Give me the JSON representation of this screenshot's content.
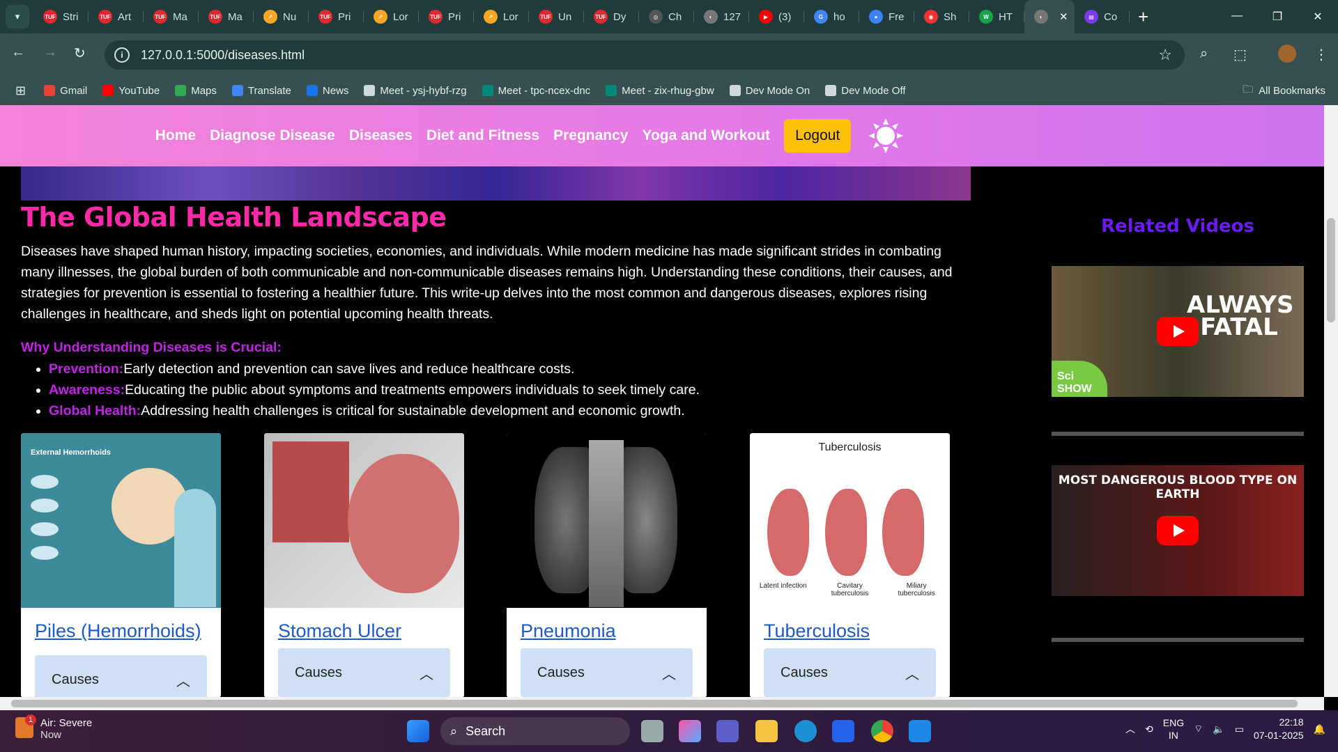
{
  "browser": {
    "tabs": [
      {
        "label": "Stri",
        "fav": "TUF",
        "color": "#e0282f"
      },
      {
        "label": "Art",
        "fav": "TUF",
        "color": "#e0282f"
      },
      {
        "label": "Ma",
        "fav": "TUF",
        "color": "#e0282f"
      },
      {
        "label": "Ma",
        "fav": "TUF",
        "color": "#e0282f"
      },
      {
        "label": "Nu",
        "fav": "↗",
        "color": "#f5a623"
      },
      {
        "label": "Pri",
        "fav": "TUF",
        "color": "#e0282f"
      },
      {
        "label": "Lor",
        "fav": "↗",
        "color": "#f5a623"
      },
      {
        "label": "Pri",
        "fav": "TUF",
        "color": "#e0282f"
      },
      {
        "label": "Lor",
        "fav": "↗",
        "color": "#f5a623"
      },
      {
        "label": "Un",
        "fav": "TUF",
        "color": "#e0282f"
      },
      {
        "label": "Dy",
        "fav": "TUF",
        "color": "#e0282f"
      },
      {
        "label": "Ch",
        "fav": "◎",
        "color": "#555"
      },
      {
        "label": "127",
        "fav": "◐",
        "color": "#777"
      },
      {
        "label": "(3)",
        "fav": "▶",
        "color": "#f00"
      },
      {
        "label": "ho",
        "fav": "G",
        "color": "#4285f4"
      },
      {
        "label": "Fre",
        "fav": "●",
        "color": "#3b82f6"
      },
      {
        "label": "Sh",
        "fav": "◉",
        "color": "#e33"
      },
      {
        "label": "HT",
        "fav": "W",
        "color": "#16a34a"
      },
      {
        "label": "",
        "fav": "◐",
        "color": "#777",
        "active": true
      },
      {
        "label": "Co",
        "fav": "▤",
        "color": "#7c3aed"
      }
    ],
    "url": "127.0.0.1:5000/diseases.html",
    "bookmarks": [
      {
        "label": "Gmail",
        "color": "#ea4335"
      },
      {
        "label": "YouTube",
        "color": "#ff0000"
      },
      {
        "label": "Maps",
        "color": "#34a853"
      },
      {
        "label": "Translate",
        "color": "#4285f4"
      },
      {
        "label": "News",
        "color": "#1a73e8"
      },
      {
        "label": "Meet - ysj-hybf-rzg",
        "color": "#cfd8dc"
      },
      {
        "label": "Meet - tpc-ncex-dnc",
        "color": "#00897b"
      },
      {
        "label": "Meet - zix-rhug-gbw",
        "color": "#00897b"
      },
      {
        "label": "Dev Mode On",
        "color": "#cfd8dc"
      },
      {
        "label": "Dev Mode Off",
        "color": "#cfd8dc"
      }
    ],
    "all_bookmarks": "All Bookmarks"
  },
  "nav": {
    "links": [
      "Home",
      "Diagnose Disease",
      "Diseases",
      "Diet and Fitness",
      "Pregnancy",
      "Yoga and Workout"
    ],
    "logout": "Logout"
  },
  "main": {
    "title": "The Global Health Landscape",
    "intro": "Diseases have shaped human history, impacting societies, economies, and individuals. While modern medicine has made significant strides in combating many illnesses, the global burden of both communicable and non-communicable diseases remains high. Understanding these conditions, their causes, and strategies for prevention is essential to fostering a healthier future. This write-up delves into the most common and dangerous diseases, explores rising challenges in healthcare, and sheds light on potential upcoming health threats.",
    "why": "Why Understanding Diseases is Crucial:",
    "points": [
      {
        "label": "Prevention:",
        "text": "Early detection and prevention can save lives and reduce healthcare costs."
      },
      {
        "label": "Awareness:",
        "text": "Educating the public about symptoms and treatments empowers individuals to seek timely care."
      },
      {
        "label": "Global Health:",
        "text": "Addressing health challenges is critical for sustainable development and economic growth."
      }
    ],
    "cards": [
      {
        "name": "Piles (Hemorrhoids)",
        "accordion": "Causes",
        "img_text": "External Hemorrhoids"
      },
      {
        "name": "Stomach Ulcer",
        "accordion": "Causes"
      },
      {
        "name": "Pneumonia",
        "accordion": "Causes"
      },
      {
        "name": "Tuberculosis",
        "accordion": "Causes",
        "img_text": "Tuberculosis",
        "img_labels": [
          "Latent infection",
          "Cavitary tuberculosis",
          "Miliary tuberculosis"
        ]
      }
    ]
  },
  "sidebar": {
    "title": "Related Videos",
    "videos": [
      {
        "overlay": "ALWAYS FATAL",
        "channel": "Sci SHOW"
      },
      {
        "overlay": "MOST DANGEROUS BLOOD TYPE ON EARTH"
      }
    ]
  },
  "taskbar": {
    "weather_title": "Air: Severe",
    "weather_sub": "Now",
    "weather_badge": "1",
    "search": "Search",
    "lang1": "ENG",
    "lang2": "IN",
    "time": "22:18",
    "date": "07-01-2025"
  }
}
